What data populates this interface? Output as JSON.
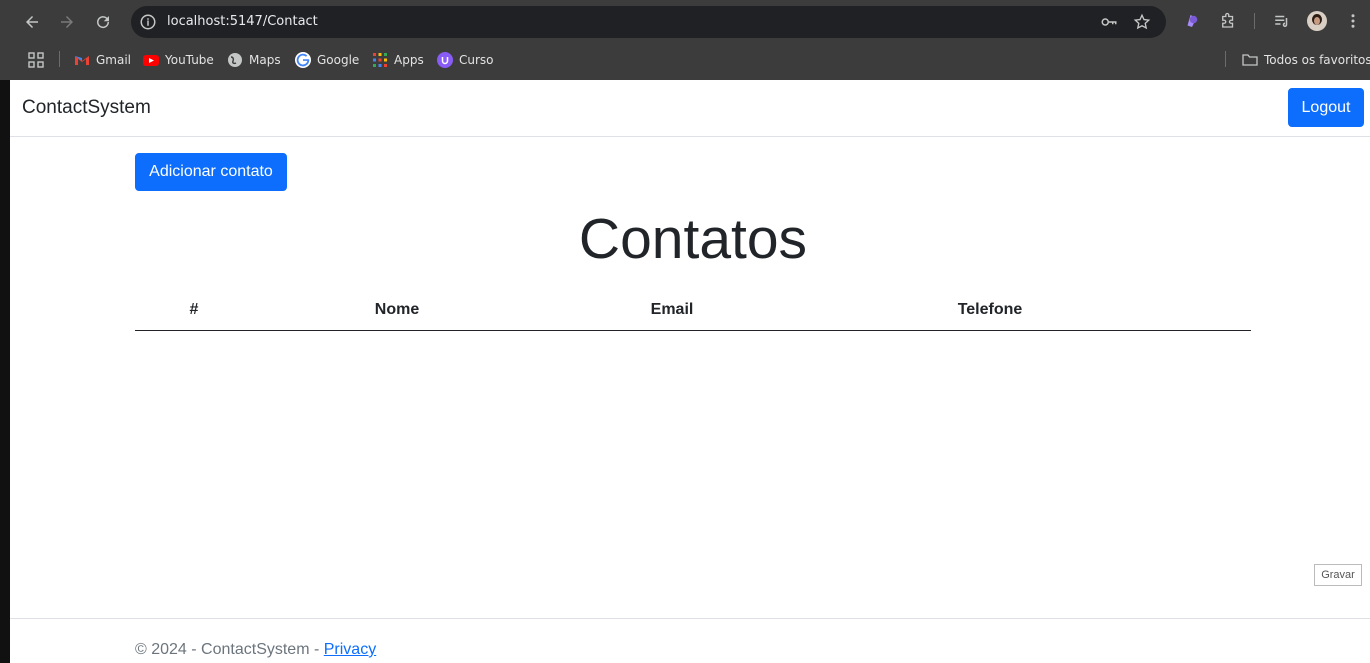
{
  "browser": {
    "url": "localhost:5147/Contact",
    "bookmarks": [
      {
        "label": "Gmail",
        "icon": "gmail-icon"
      },
      {
        "label": "YouTube",
        "icon": "youtube-icon"
      },
      {
        "label": "Maps",
        "icon": "maps-icon"
      },
      {
        "label": "Google",
        "icon": "google-icon"
      },
      {
        "label": "Apps",
        "icon": "apps-grid-icon"
      },
      {
        "label": "Curso",
        "icon": "curso-icon"
      }
    ],
    "all_bookmarks_label": "Todos os favoritos"
  },
  "navbar": {
    "brand": "ContactSystem",
    "logout_label": "Logout"
  },
  "main": {
    "add_button_label": "Adicionar contato",
    "title": "Contatos",
    "table": {
      "columns": [
        "#",
        "Nome",
        "Email",
        "Telefone"
      ],
      "rows": []
    }
  },
  "footer": {
    "prefix": "© 2024 - ContactSystem - ",
    "privacy_link": "Privacy"
  },
  "recorder": {
    "label": "Gravar"
  },
  "colors": {
    "primary": "#0d6efd",
    "chrome_bg": "#3c3c3c",
    "omnibox_bg": "#202124"
  }
}
